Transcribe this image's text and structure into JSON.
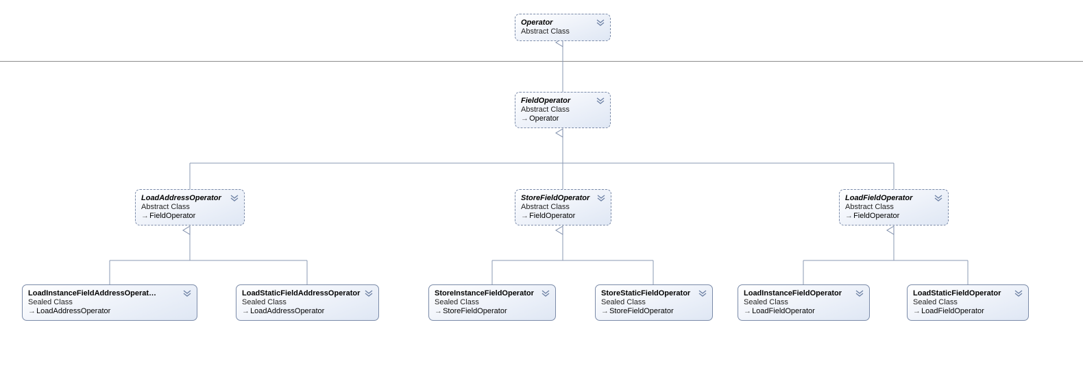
{
  "nodes": {
    "operator": {
      "title": "Operator",
      "sub": "Abstract Class",
      "base": null
    },
    "fieldOperator": {
      "title": "FieldOperator",
      "sub": "Abstract Class",
      "base": "Operator"
    },
    "loadAddressOperator": {
      "title": "LoadAddressOperator",
      "sub": "Abstract Class",
      "base": "FieldOperator"
    },
    "storeFieldOperator": {
      "title": "StoreFieldOperator",
      "sub": "Abstract Class",
      "base": "FieldOperator"
    },
    "loadFieldOperator": {
      "title": "LoadFieldOperator",
      "sub": "Abstract Class",
      "base": "FieldOperator"
    },
    "loadInstanceFieldAddr": {
      "title": "LoadInstanceFieldAddressOperat…",
      "sub": "Sealed Class",
      "base": "LoadAddressOperator"
    },
    "loadStaticFieldAddr": {
      "title": "LoadStaticFieldAddressOperator",
      "sub": "Sealed Class",
      "base": "LoadAddressOperator"
    },
    "storeInstanceField": {
      "title": "StoreInstanceFieldOperator",
      "sub": "Sealed Class",
      "base": "StoreFieldOperator"
    },
    "storeStaticField": {
      "title": "StoreStaticFieldOperator",
      "sub": "Sealed Class",
      "base": "StoreFieldOperator"
    },
    "loadInstanceField": {
      "title": "LoadInstanceFieldOperator",
      "sub": "Sealed Class",
      "base": "LoadFieldOperator"
    },
    "loadStaticField": {
      "title": "LoadStaticFieldOperator",
      "sub": "Sealed Class",
      "base": "LoadFieldOperator"
    }
  }
}
